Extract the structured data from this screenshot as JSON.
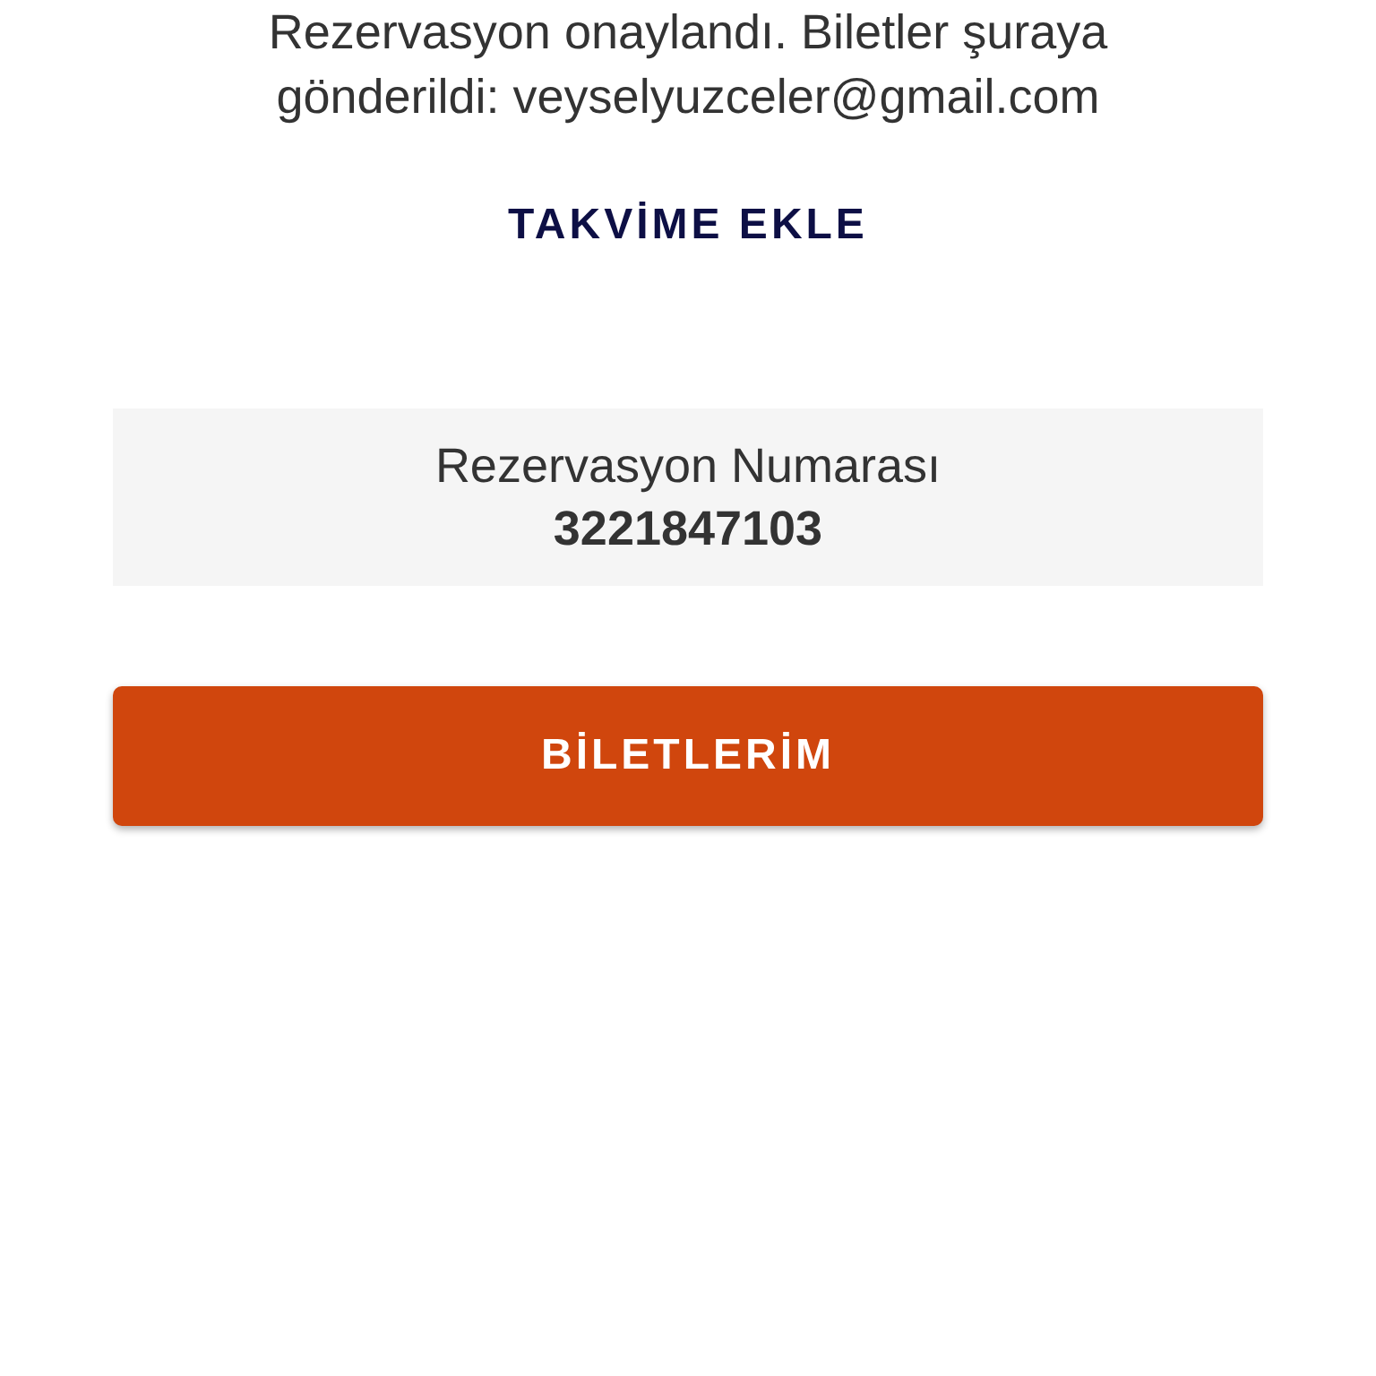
{
  "confirmation": {
    "message": "Rezervasyon onaylandı. Biletler şuraya gönderildi: veyselyuzceler@gmail.com"
  },
  "calendar_link": {
    "label": "TAKVİME EKLE"
  },
  "reservation": {
    "label": "Rezervasyon Numarası",
    "number": "3221847103"
  },
  "tickets_button": {
    "label": "BİLETLERİM"
  }
}
